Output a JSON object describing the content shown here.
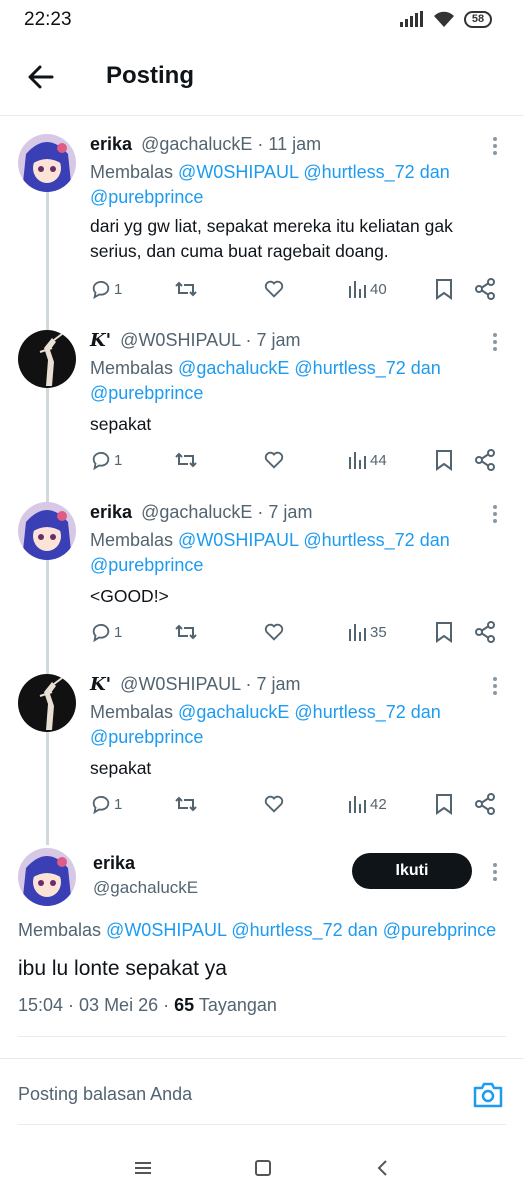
{
  "status_bar": {
    "time": "22:23",
    "battery": "58"
  },
  "header": {
    "title": "Posting"
  },
  "tweets": [
    {
      "name": "erika",
      "handle": "@gachaluckE",
      "time": "· 11 jam",
      "reply_prefix": "Membalas",
      "mentions": [
        "@W0SHIPAUL",
        "@hurtless_72"
      ],
      "conj": "dan",
      "last_mention": "@purebprince",
      "text": "dari yg gw liat, sepakat mereka itu keliatan gak serius, dan cuma buat ragebait doang.",
      "replies": "1",
      "views": "40"
    },
    {
      "name": "K'",
      "handle": "@W0SHIPAUL",
      "time": "· 7 jam",
      "reply_prefix": "Membalas",
      "mentions": [
        "@gachaluckE",
        "@hurtless_72"
      ],
      "conj": "dan",
      "last_mention": "@purebprince",
      "text": "sepakat",
      "replies": "1",
      "views": "44"
    },
    {
      "name": "erika",
      "handle": "@gachaluckE",
      "time": "· 7 jam",
      "reply_prefix": "Membalas",
      "mentions": [
        "@W0SHIPAUL",
        "@hurtless_72"
      ],
      "conj": "dan",
      "last_mention": "@purebprince",
      "text": "<GOOD!>",
      "replies": "1",
      "views": "35"
    },
    {
      "name": "K'",
      "handle": "@W0SHIPAUL",
      "time": "· 7 jam",
      "reply_prefix": "Membalas",
      "mentions": [
        "@gachaluckE",
        "@hurtless_72"
      ],
      "conj": "dan",
      "last_mention": "@purebprince",
      "text": "sepakat",
      "replies": "1",
      "views": "42"
    }
  ],
  "main_tweet": {
    "name": "erika",
    "handle": "@gachaluckE",
    "follow_label": "Ikuti",
    "reply_prefix": "Membalas",
    "mention1": "@W0SHIPAUL",
    "mention2": "@hurtless_72",
    "conj": "dan",
    "mention3": "@purebprince",
    "text": "ibu lu lonte sepakat ya",
    "time": "15:04 · 03 Mei 26 ·",
    "views": "65",
    "views_label": "Tayangan"
  },
  "composer": {
    "placeholder": "Posting balasan Anda"
  },
  "colors": {
    "link": "#1d9bf0",
    "text": "#0f1419",
    "muted": "#536471"
  }
}
